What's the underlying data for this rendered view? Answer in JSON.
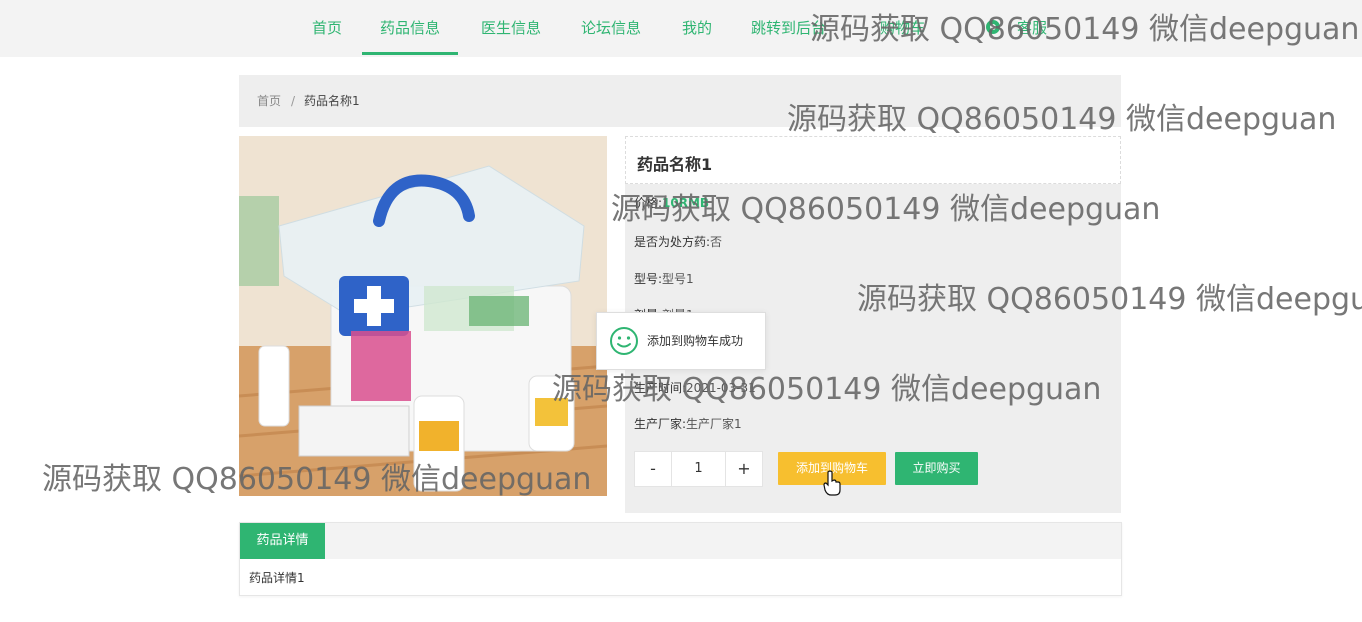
{
  "nav": {
    "items": [
      {
        "label": "首页"
      },
      {
        "label": "药品信息"
      },
      {
        "label": "医生信息"
      },
      {
        "label": "论坛信息"
      },
      {
        "label": "我的"
      },
      {
        "label": "跳转到后台"
      },
      {
        "label": "购物车"
      },
      {
        "label": "客服"
      }
    ],
    "active_index": 1
  },
  "breadcrumb": {
    "home": "首页",
    "separator": "/",
    "current": "药品名称1"
  },
  "product": {
    "name": "药品名称1",
    "price_label": "价格:",
    "price": "10RMB",
    "rx_label": "是否为处方药:",
    "rx_value": "否",
    "model_label": "型号:",
    "model_value": "型号1",
    "spec_label": "剂量:",
    "spec_value": "剂量1",
    "date_label": "生产时间:",
    "date_value": "2021-03-31",
    "maker_label": "生产厂家:",
    "maker_value": "生产厂家1",
    "image_icon": "medicine-box-image"
  },
  "purchase": {
    "minus": "-",
    "quantity": "1",
    "plus": "+",
    "add_to_cart": "添加到购物车",
    "buy_now": "立即购买"
  },
  "toast": {
    "message": "添加到购物车成功",
    "icon": "smile-icon"
  },
  "details": {
    "tab": "药品详情",
    "content": "药品详情1"
  },
  "watermark": {
    "text": "源码获取 QQ86050149 微信deepguan"
  },
  "colors": {
    "accent": "#2fb572",
    "cart_button": "#f7bf2f",
    "panel_bg": "#eeeeee"
  }
}
